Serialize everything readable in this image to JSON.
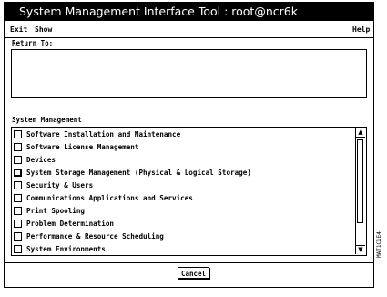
{
  "window": {
    "title": "System Management Interface Tool : root@ncr6k"
  },
  "menubar": {
    "exit_label": "Exit",
    "show_label": "Show",
    "help_label": "Help"
  },
  "return_to": {
    "label": "Return To:"
  },
  "system_management": {
    "label": "System Management",
    "items": [
      {
        "label": "Software Installation and Maintenance"
      },
      {
        "label": "Software License Management"
      },
      {
        "label": "Devices"
      },
      {
        "label": "System Storage Management (Physical & Logical Storage)"
      },
      {
        "label": "Security & Users"
      },
      {
        "label": "Communications Applications and Services"
      },
      {
        "label": "Print Spooling"
      },
      {
        "label": "Problem Determination"
      },
      {
        "label": "Performance & Resource Scheduling"
      },
      {
        "label": "System Environments"
      }
    ]
  },
  "buttons": {
    "cancel_label": "Cancel"
  },
  "figure_id": "MAT1C1E4"
}
